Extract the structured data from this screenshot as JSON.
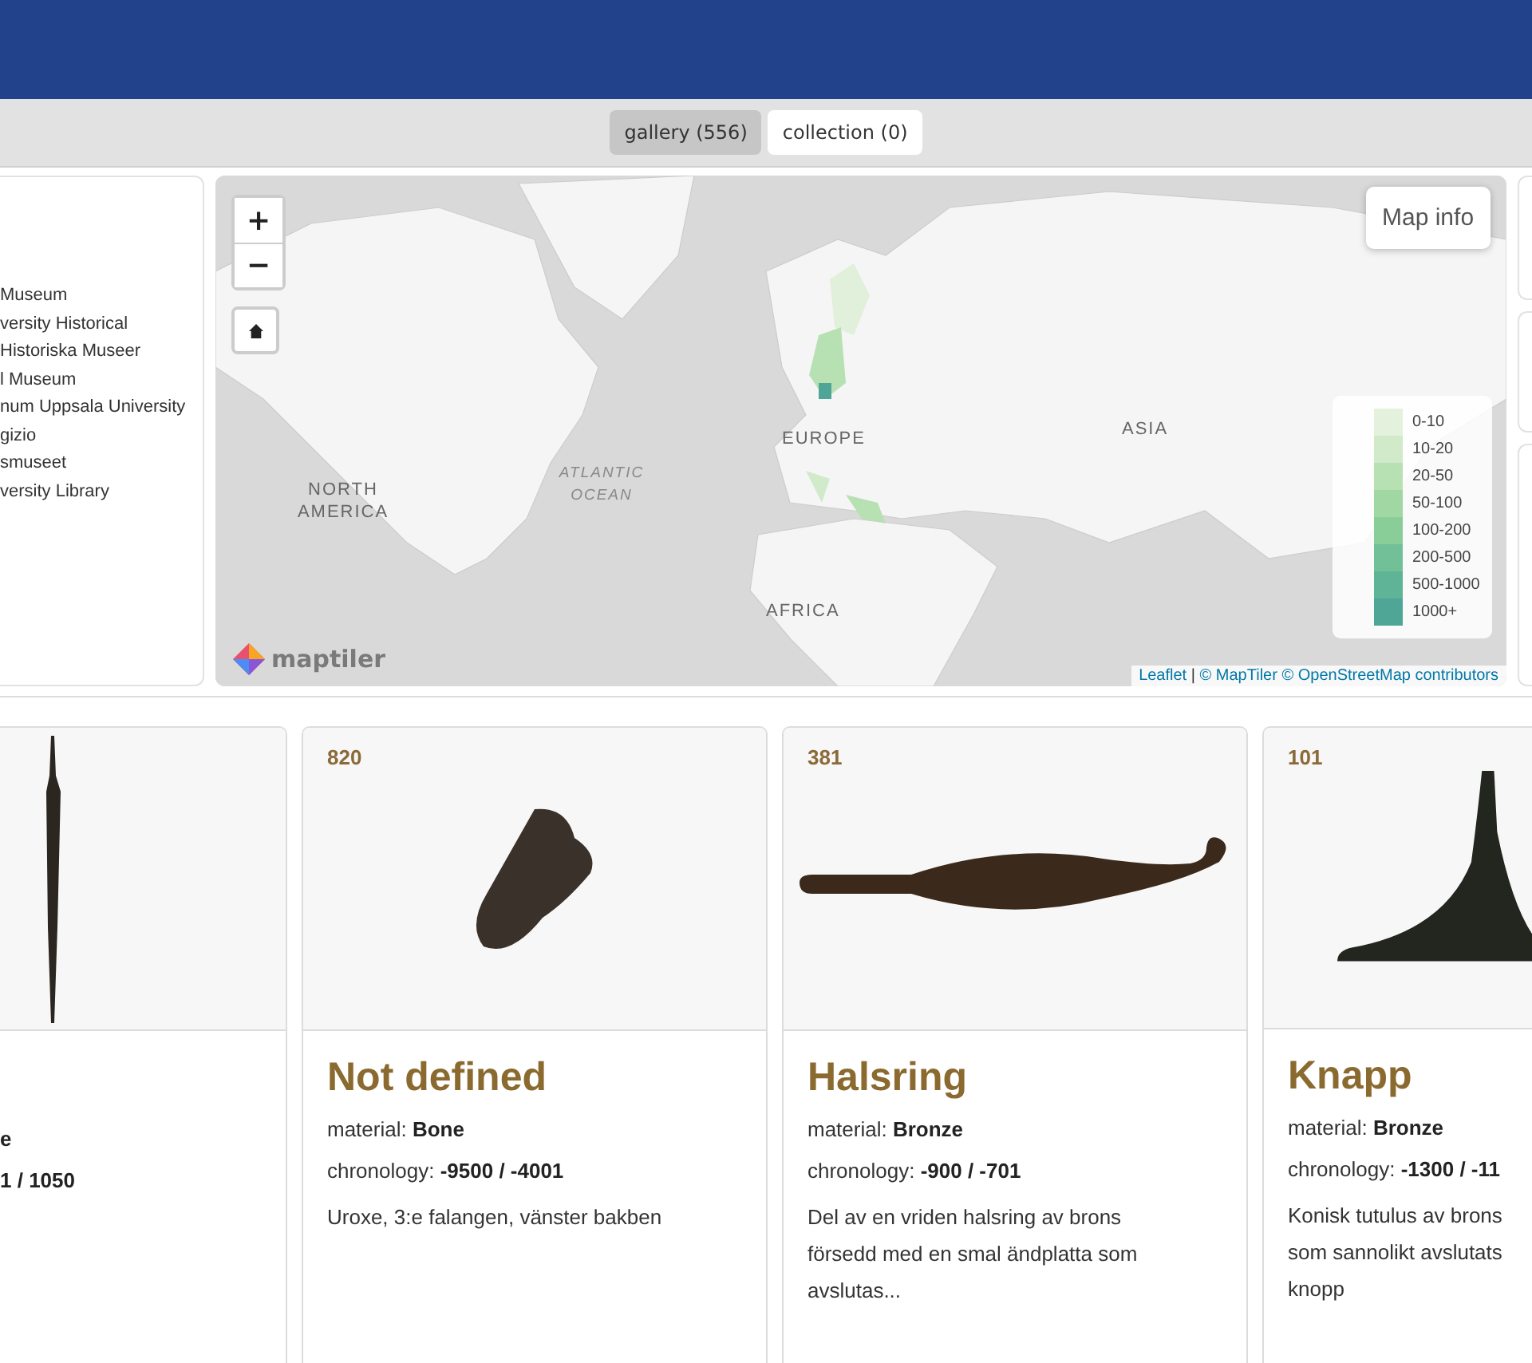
{
  "view_tabs": [
    {
      "label": "gallery (556)",
      "selected": true
    },
    {
      "label": "collection (0)",
      "selected": false
    }
  ],
  "sources": [
    "Museum",
    "versity Historical",
    "Historiska Museer",
    "l Museum",
    "num Uppsala University",
    "gizio",
    "smuseet",
    "versity Library"
  ],
  "map": {
    "zoom_in": "+",
    "zoom_out": "−",
    "info_button": "Map info",
    "labels": [
      {
        "text": "NORTH AMERICA",
        "kind": "continent"
      },
      {
        "text": "ATLANTIC OCEAN",
        "kind": "ocean"
      },
      {
        "text": "EUROPE",
        "kind": "continent"
      },
      {
        "text": "ASIA",
        "kind": "continent"
      },
      {
        "text": "AFRICA",
        "kind": "continent"
      }
    ],
    "legend": [
      {
        "label": "0-10",
        "color": "#e4f2dd"
      },
      {
        "label": "10-20",
        "color": "#d0eaca"
      },
      {
        "label": "20-50",
        "color": "#b8e1b3"
      },
      {
        "label": "50-100",
        "color": "#a0d7a3"
      },
      {
        "label": "100-200",
        "color": "#89cd99"
      },
      {
        "label": "200-500",
        "color": "#72c097"
      },
      {
        "label": "500-1000",
        "color": "#5fb396"
      },
      {
        "label": "1000+",
        "color": "#4fa596"
      }
    ],
    "logo": "maptiler",
    "attribution": {
      "leaflet": "Leaflet",
      "separator": "|",
      "maptiler": "© MapTiler",
      "osm": "© OpenStreetMap contributors"
    }
  },
  "cards": [
    {
      "kind": "cut-left",
      "material": "e",
      "chronology": "1 / 1050"
    },
    {
      "kind": "full",
      "number": "820",
      "title": "Not defined",
      "material_label": "material:",
      "material": "Bone",
      "chronology_label": "chronology:",
      "chronology": "-9500 / -4001",
      "description_lines": [
        "Uroxe, 3:e falangen, vänster bakben"
      ]
    },
    {
      "kind": "full",
      "number": "381",
      "title": "Halsring",
      "material_label": "material:",
      "material": "Bronze",
      "chronology_label": "chronology:",
      "chronology": "-900 / -701",
      "description_lines": [
        "Del av en vriden halsring av brons",
        "försedd med en smal ändplatta som",
        "avslutas..."
      ]
    },
    {
      "kind": "cut-right",
      "number": "101",
      "title": "Knapp",
      "material_label": "material:",
      "material": "Bronze",
      "chronology_label": "chronology:",
      "chronology": "-1300 / -11",
      "description_lines": [
        "Konisk tutulus av brons",
        "som sannolikt avslutats",
        "knopp"
      ]
    }
  ]
}
